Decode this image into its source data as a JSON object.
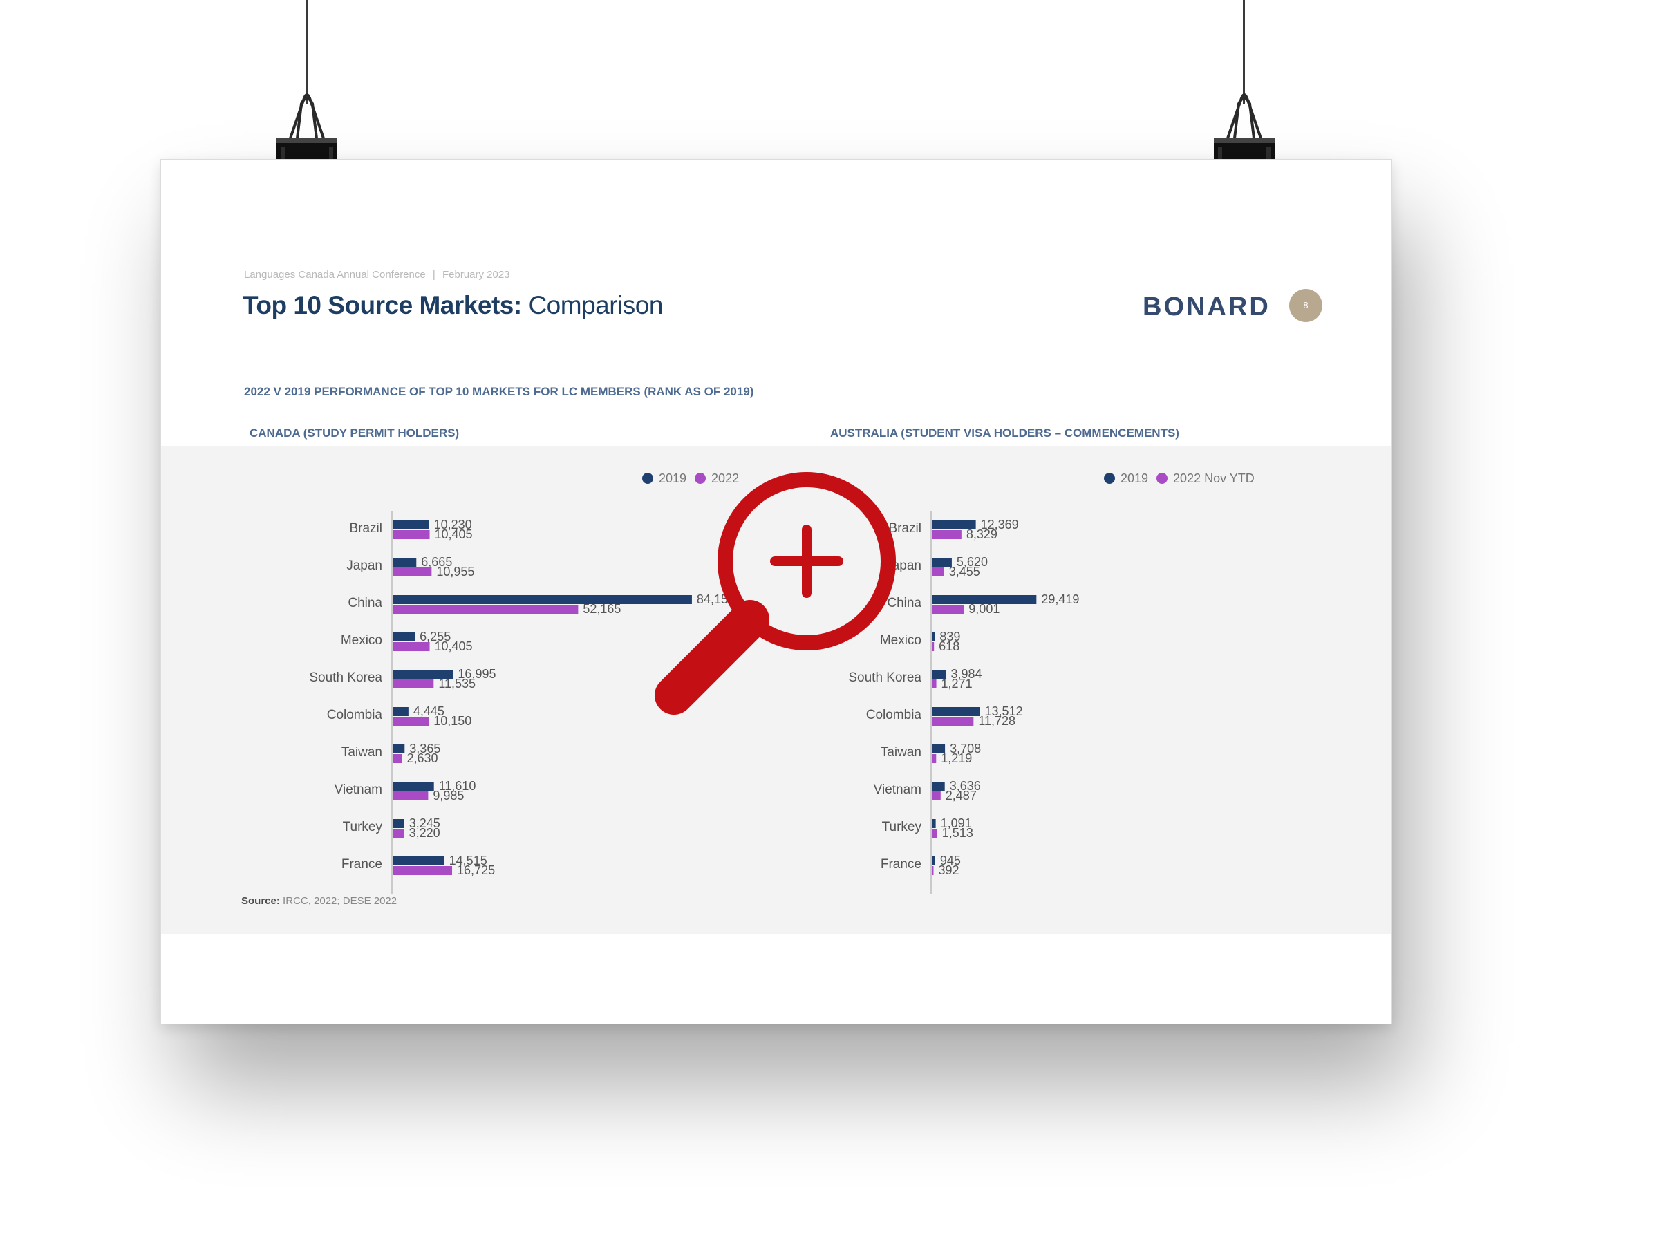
{
  "header": {
    "conference": "Languages Canada Annual Conference",
    "separator": "|",
    "date": "February 2023",
    "title_bold": "Top 10 Source Markets:",
    "title_light": "Comparison",
    "brand": "BONARD",
    "page_number": "8"
  },
  "subtitle": "2022 V 2019 PERFORMANCE OF TOP 10 MARKETS FOR LC MEMBERS (RANK AS OF 2019)",
  "source": {
    "label": "Source:",
    "text": "IRCC, 2022; DESE 2022"
  },
  "colors": {
    "series_2019": "#1f3f6e",
    "series_2022": "#a94bc4",
    "chart_bg": "#f3f3f3",
    "magnifier": "#c41015"
  },
  "icons": {
    "zoom": "zoom-in-icon",
    "clip": "binder-clip-icon"
  },
  "chart_data": [
    {
      "type": "bar",
      "orientation": "horizontal",
      "title": "CANADA (STUDY PERMIT HOLDERS)",
      "categories": [
        "Brazil",
        "Japan",
        "China",
        "Mexico",
        "South Korea",
        "Colombia",
        "Taiwan",
        "Vietnam",
        "Turkey",
        "France"
      ],
      "series": [
        {
          "name": "2019",
          "values": [
            10230,
            6665,
            84155,
            6255,
            16995,
            4445,
            3365,
            11610,
            3245,
            14515
          ]
        },
        {
          "name": "2022",
          "values": [
            10405,
            10955,
            52165,
            10405,
            11535,
            10150,
            2630,
            9985,
            3220,
            16725
          ]
        }
      ],
      "value_labels": [
        [
          "10,230",
          "6,665",
          "84,155",
          "6,255",
          "16,995",
          "4,445",
          "3,365",
          "11,610",
          "3,245",
          "14,515"
        ],
        [
          "10,405",
          "10,955",
          "52,165",
          "10,405",
          "11,535",
          "10,150",
          "2,630",
          "9,985",
          "3,220",
          "16,725"
        ]
      ],
      "xlim": [
        0,
        90000
      ],
      "legend": "top-right",
      "grid": false
    },
    {
      "type": "bar",
      "orientation": "horizontal",
      "title": "AUSTRALIA (STUDENT VISA HOLDERS – COMMENCEMENTS)",
      "categories": [
        "Brazil",
        "Japan",
        "China",
        "Mexico",
        "South Korea",
        "Colombia",
        "Taiwan",
        "Vietnam",
        "Turkey",
        "France"
      ],
      "series": [
        {
          "name": "2019",
          "values": [
            12369,
            5620,
            29419,
            839,
            3984,
            13512,
            3708,
            3636,
            1091,
            945
          ]
        },
        {
          "name": "2022 Nov YTD",
          "values": [
            8329,
            3455,
            9001,
            618,
            1271,
            11728,
            1219,
            2487,
            1513,
            392
          ]
        }
      ],
      "value_labels": [
        [
          "12,369",
          "5,620",
          "29,419",
          "839",
          "3,984",
          "13,512",
          "3,708",
          "3,636",
          "1,091",
          "945"
        ],
        [
          "8,329",
          "3,455",
          "9,001",
          "618",
          "1,271",
          "11,728",
          "1,219",
          "2,487",
          "1,513",
          "392"
        ]
      ],
      "xlim": [
        0,
        90000
      ],
      "legend": "top-right",
      "grid": false
    }
  ]
}
